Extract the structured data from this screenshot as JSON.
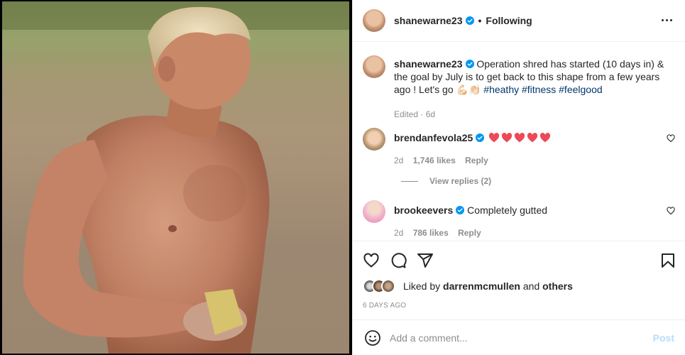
{
  "post_author": {
    "username": "shanewarne23",
    "follow_status": "Following",
    "verified": true
  },
  "caption": {
    "username": "shanewarne23",
    "text": "Operation shred has started (10 days in) & the goal by July is to get back to this shape from a few years ago ! Let's go",
    "emojis": "💪🏻👏🏻",
    "hashtags": [
      "#heathy",
      "#fitness",
      "#feelgood"
    ],
    "meta": "Edited · 6d"
  },
  "comments": [
    {
      "username": "brendanfevola25",
      "verified": true,
      "text": "",
      "hearts": 5,
      "time": "2d",
      "likes": "1,746 likes",
      "reply_label": "Reply"
    },
    {
      "username": "brookeevers",
      "verified": true,
      "text": "Completely gutted",
      "time": "2d",
      "likes": "786 likes",
      "reply_label": "Reply"
    }
  ],
  "view_replies": "View replies (2)",
  "likes_line": {
    "prefix": "Liked by",
    "user": "darrenmcmullen",
    "connector": "and",
    "others": "others"
  },
  "timestamp": "6 DAYS AGO",
  "add_comment": {
    "placeholder": "Add a comment...",
    "post_label": "Post"
  },
  "colors": {
    "verified_blue": "#0095f6",
    "heart_red": "#ed4956",
    "hashtag": "#00376b",
    "muted": "#8e8e8e",
    "post_button_disabled": "#b2dffc"
  },
  "icons": [
    "heart-icon",
    "comment-icon",
    "share-icon",
    "bookmark-icon",
    "more-options-icon",
    "emoji-icon",
    "verified-badge-icon"
  ]
}
